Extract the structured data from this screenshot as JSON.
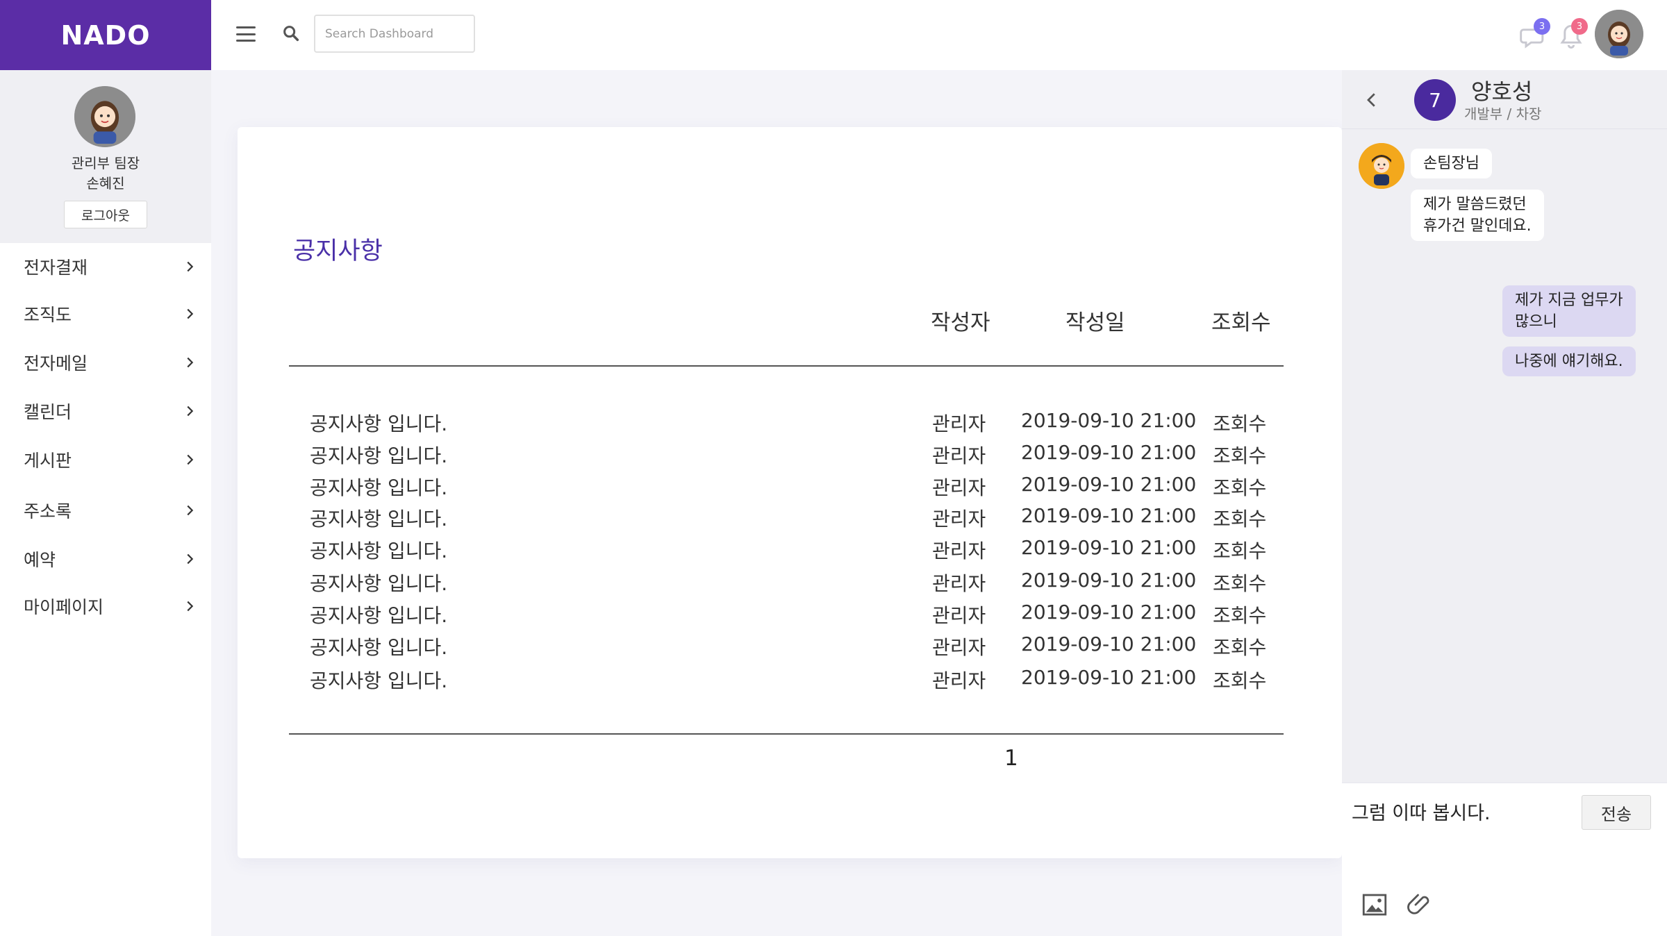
{
  "brand": "NADO",
  "search": {
    "placeholder": "Search Dashboard"
  },
  "topbar": {
    "messages_badge": "3",
    "notifications_badge": "3",
    "badge_colors": {
      "messages": "#7b6ff0",
      "notifications": "#f06a8a"
    }
  },
  "profile": {
    "role": "관리부 팀장",
    "name": "손혜진",
    "logout_label": "로그아웃"
  },
  "sidebar": {
    "items": [
      {
        "label": "전자결재"
      },
      {
        "label": "조직도"
      },
      {
        "label": "전자메일"
      },
      {
        "label": "캘린더"
      },
      {
        "label": "게시판"
      },
      {
        "label": "주소록"
      },
      {
        "label": "예약"
      },
      {
        "label": "마이페이지"
      }
    ]
  },
  "notice": {
    "title": "공지사항",
    "columns": {
      "author": "작성자",
      "date": "작성일",
      "views": "조회수"
    },
    "rows": [
      {
        "title": "공지사항 입니다.",
        "author": "관리자",
        "date": "2019-09-10 21:00",
        "views": "조회수"
      },
      {
        "title": "공지사항 입니다.",
        "author": "관리자",
        "date": "2019-09-10 21:00",
        "views": "조회수"
      },
      {
        "title": "공지사항 입니다.",
        "author": "관리자",
        "date": "2019-09-10 21:00",
        "views": "조회수"
      },
      {
        "title": "공지사항 입니다.",
        "author": "관리자",
        "date": "2019-09-10 21:00",
        "views": "조회수"
      },
      {
        "title": "공지사항 입니다.",
        "author": "관리자",
        "date": "2019-09-10 21:00",
        "views": "조회수"
      },
      {
        "title": "공지사항 입니다.",
        "author": "관리자",
        "date": "2019-09-10 21:00",
        "views": "조회수"
      },
      {
        "title": "공지사항 입니다.",
        "author": "관리자",
        "date": "2019-09-10 21:00",
        "views": "조회수"
      },
      {
        "title": "공지사항 입니다.",
        "author": "관리자",
        "date": "2019-09-10 21:00",
        "views": "조회수"
      },
      {
        "title": "공지사항 입니다.",
        "author": "관리자",
        "date": "2019-09-10 21:00",
        "views": "조회수"
      }
    ],
    "page": "1"
  },
  "chat": {
    "number": "7",
    "name": "양호성",
    "dept": "개발부 / 차장",
    "messages": [
      {
        "from": "in",
        "text": "손팀장님"
      },
      {
        "from": "in",
        "text": "제가 말씀드렸던\n휴가건 말인데요."
      },
      {
        "from": "out",
        "text": "제가 지금 업무가\n많으니"
      },
      {
        "from": "out",
        "text": "나중에 얘기해요."
      }
    ],
    "input_value": "그럼 이따 봅시다.",
    "send_label": "전송"
  },
  "colors": {
    "brand": "#5b2da6",
    "title": "#4a30a8",
    "chat_number": "#4a2a9e",
    "bubble_out": "#dcd8f2"
  }
}
